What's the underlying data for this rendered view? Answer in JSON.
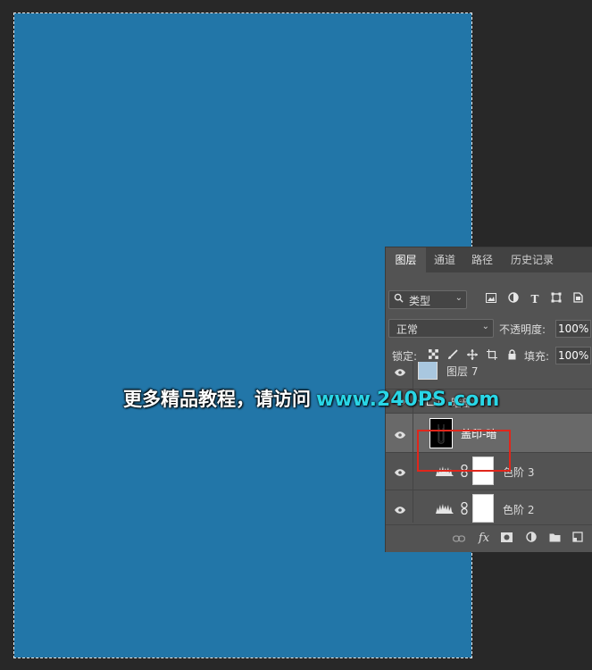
{
  "watermark": {
    "chinese": "更多精品教程，请访问",
    "url": "www.240PS.com"
  },
  "panel": {
    "tabs": [
      {
        "label": "图层",
        "active": true
      },
      {
        "label": "通道",
        "active": false
      },
      {
        "label": "路径",
        "active": false
      },
      {
        "label": "历史记录",
        "active": false
      }
    ],
    "filter": {
      "label": "类型",
      "icons": [
        "image-filter-icon",
        "adjustment-filter-icon",
        "text-filter-icon",
        "shape-filter-icon",
        "smart-object-filter-icon"
      ]
    },
    "blend_mode": "正常",
    "opacity_label": "不透明度:",
    "opacity_value": "100%",
    "lock_label": "锁定:",
    "fill_label": "填充:",
    "fill_value": "100%",
    "layers": [
      {
        "name": "图层 7",
        "type": "pixel",
        "visible": true
      },
      {
        "name": "暗部",
        "type": "group",
        "visible": true,
        "expanded": true
      },
      {
        "name": "盖印-暗",
        "type": "pixel",
        "visible": true,
        "selected": true
      },
      {
        "name": "色阶 3",
        "type": "adjustment",
        "visible": true
      },
      {
        "name": "色阶 2",
        "type": "adjustment",
        "visible": true
      }
    ]
  },
  "colors": {
    "canvas": "#2276a8",
    "highlight": "#e0261b",
    "url": "#29d6e6"
  }
}
